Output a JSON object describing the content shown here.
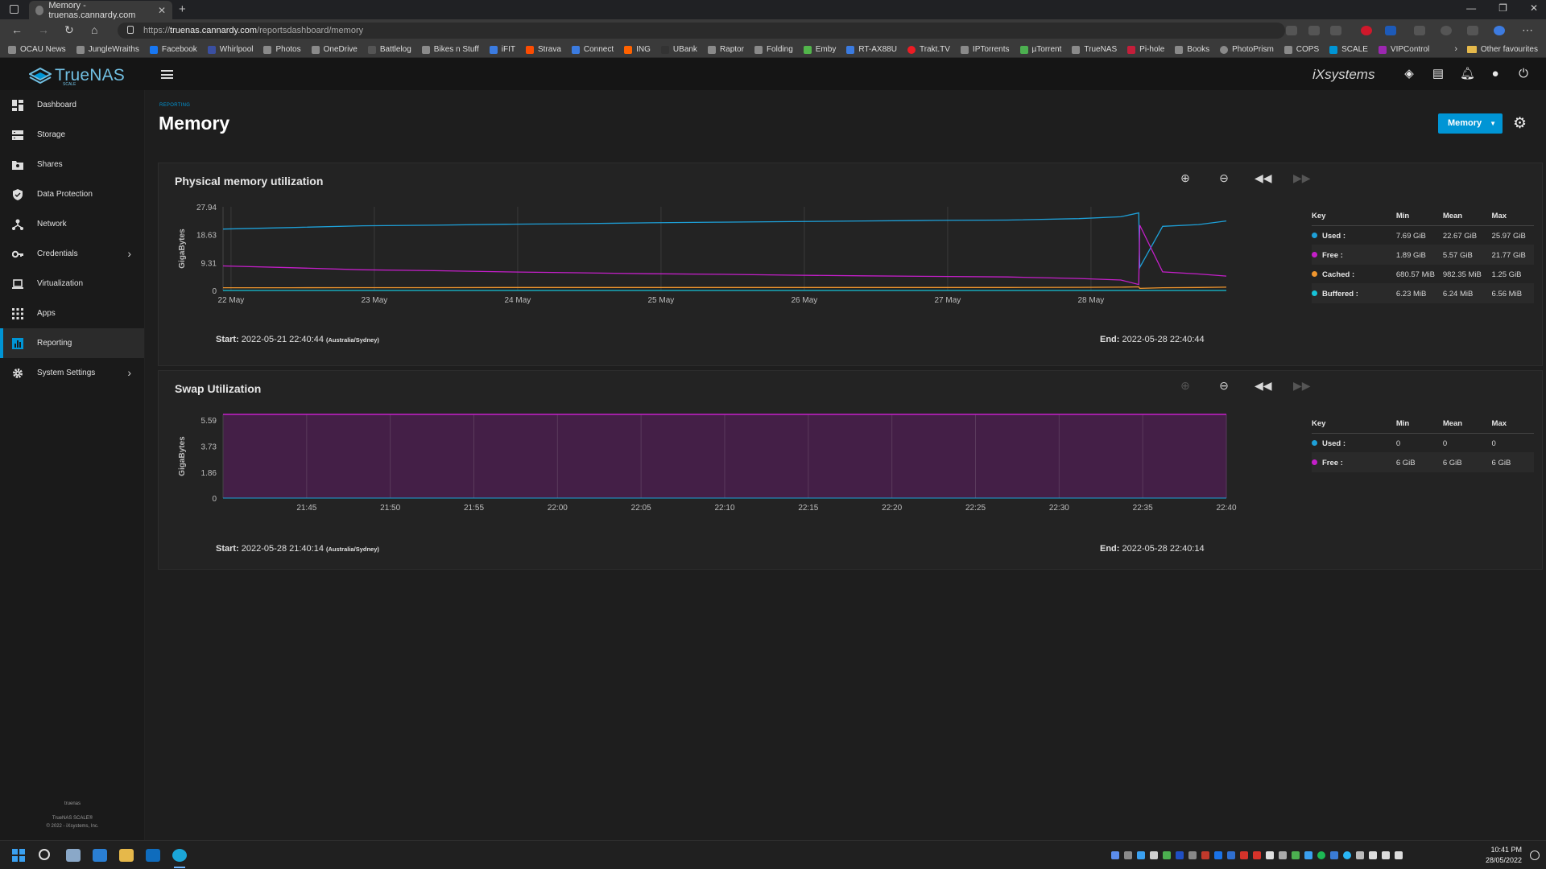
{
  "browser": {
    "tab_title": "Memory - truenas.cannardy.com",
    "url_prefix": "https://",
    "url_host": "truenas.cannardy.com",
    "url_path": "/reportsdashboard/memory",
    "bookmarks": [
      "OCAU News",
      "JungleWraiths",
      "Facebook",
      "Whirlpool",
      "Photos",
      "OneDrive",
      "Battlelog",
      "Bikes n Stuff",
      "iFIT",
      "Strava",
      "Connect",
      "ING",
      "UBank",
      "Raptor",
      "Folding",
      "Emby",
      "RT-AX88U",
      "Trakt.TV",
      "IPTorrents",
      "µTorrent",
      "TrueNAS",
      "Pi-hole",
      "Books",
      "PhotoPrism",
      "COPS",
      "SCALE",
      "VIPControl"
    ],
    "other_favourites": "Other favourites"
  },
  "app": {
    "logo_text": "TrueNAS",
    "logo_sub": "SCALE",
    "vendor": "iXsystems"
  },
  "sidebar": {
    "items": [
      {
        "label": "Dashboard",
        "icon": "dashboard-icon"
      },
      {
        "label": "Storage",
        "icon": "storage-icon"
      },
      {
        "label": "Shares",
        "icon": "shares-icon"
      },
      {
        "label": "Data Protection",
        "icon": "shield-icon"
      },
      {
        "label": "Network",
        "icon": "network-icon"
      },
      {
        "label": "Credentials",
        "icon": "key-icon"
      },
      {
        "label": "Virtualization",
        "icon": "laptop-icon"
      },
      {
        "label": "Apps",
        "icon": "apps-grid-icon"
      },
      {
        "label": "Reporting",
        "icon": "chart-icon"
      },
      {
        "label": "System Settings",
        "icon": "gear-icon"
      }
    ],
    "footer_host": "truenas",
    "footer_product": "TrueNAS SCALE®",
    "footer_copyright": "© 2022 - iXsystems, Inc."
  },
  "page": {
    "breadcrumb": "REPORTING",
    "title": "Memory",
    "selector_label": "Memory"
  },
  "memory_card": {
    "title": "Physical memory utilization",
    "ylabel": "GigaBytes",
    "yticks": [
      "27.94",
      "18.63",
      "9.31",
      "0"
    ],
    "xticks": [
      "22 May",
      "23 May",
      "24 May",
      "25 May",
      "26 May",
      "27 May",
      "28 May"
    ],
    "start_label": "Start:",
    "start_value": "2022-05-21 22:40:44",
    "start_tz": "(Australia/Sydney)",
    "end_label": "End:",
    "end_value": "2022-05-28 22:40:44",
    "legend_headers": [
      "Key",
      "Min",
      "Mean",
      "Max"
    ],
    "legend_rows": [
      {
        "name": "Used :",
        "min": "7.69 GiB",
        "mean": "22.67 GiB",
        "max": "25.97 GiB",
        "color": "#1ea0d8"
      },
      {
        "name": "Free :",
        "min": "1.89 GiB",
        "mean": "5.57 GiB",
        "max": "21.77 GiB",
        "color": "#c41fc9"
      },
      {
        "name": "Cached :",
        "min": "680.57 MiB",
        "mean": "982.35 MiB",
        "max": "1.25 GiB",
        "color": "#f0962e"
      },
      {
        "name": "Buffered :",
        "min": "6.23 MiB",
        "mean": "6.24 MiB",
        "max": "6.56 MiB",
        "color": "#16c3d8"
      }
    ]
  },
  "swap_card": {
    "title": "Swap Utilization",
    "ylabel": "GigaBytes",
    "yticks": [
      "5.59",
      "3.73",
      "1.86",
      "0"
    ],
    "xticks": [
      "21:45",
      "21:50",
      "21:55",
      "22:00",
      "22:05",
      "22:10",
      "22:15",
      "22:20",
      "22:25",
      "22:30",
      "22:35",
      "22:40"
    ],
    "start_label": "Start:",
    "start_value": "2022-05-28 21:40:14",
    "start_tz": "(Australia/Sydney)",
    "end_label": "End:",
    "end_value": "2022-05-28 22:40:14",
    "legend_headers": [
      "Key",
      "Min",
      "Mean",
      "Max"
    ],
    "legend_rows": [
      {
        "name": "Used :",
        "min": "0",
        "mean": "0",
        "max": "0",
        "color": "#1ea0d8"
      },
      {
        "name": "Free :",
        "min": "6 GiB",
        "mean": "6 GiB",
        "max": "6 GiB",
        "color": "#c41fc9"
      }
    ]
  },
  "chart_data": [
    {
      "type": "line",
      "title": "Physical memory utilization",
      "ylabel": "GigaBytes",
      "ylim": [
        0,
        27.94
      ],
      "x": [
        "2022-05-21 22:40",
        "2022-05-22 10:00",
        "2022-05-22 22:00",
        "2022-05-23 10:00",
        "2022-05-23 22:00",
        "2022-05-24 10:00",
        "2022-05-24 22:00",
        "2022-05-25 10:00",
        "2022-05-25 22:00",
        "2022-05-26 10:00",
        "2022-05-26 22:00",
        "2022-05-27 10:00",
        "2022-05-27 22:00",
        "2022-05-28 05:00",
        "2022-05-28 08:00",
        "2022-05-28 08:10",
        "2022-05-28 12:00",
        "2022-05-28 18:00",
        "2022-05-28 22:40"
      ],
      "series": [
        {
          "name": "Used",
          "values": [
            20.5,
            21.0,
            21.6,
            21.8,
            22.1,
            22.3,
            22.6,
            22.8,
            23.0,
            23.2,
            23.4,
            23.5,
            24.0,
            24.6,
            25.9,
            7.7,
            21.4,
            22.0,
            23.2
          ]
        },
        {
          "name": "Free",
          "values": [
            8.2,
            7.6,
            6.9,
            6.6,
            6.2,
            5.9,
            5.6,
            5.4,
            5.1,
            4.9,
            4.7,
            4.5,
            4.0,
            3.5,
            2.0,
            21.8,
            6.2,
            5.5,
            4.8
          ]
        },
        {
          "name": "Cached",
          "values": [
            0.9,
            0.9,
            0.95,
            0.95,
            1.0,
            1.0,
            1.0,
            1.0,
            1.0,
            1.0,
            1.0,
            1.0,
            1.05,
            1.1,
            1.2,
            0.7,
            0.9,
            1.0,
            1.1
          ]
        },
        {
          "name": "Buffered",
          "values": [
            0.006,
            0.006,
            0.006,
            0.006,
            0.006,
            0.006,
            0.006,
            0.006,
            0.006,
            0.006,
            0.006,
            0.006,
            0.006,
            0.006,
            0.006,
            0.006,
            0.006,
            0.006,
            0.006
          ]
        }
      ],
      "grid": true,
      "legend": "right"
    },
    {
      "type": "area",
      "title": "Swap Utilization",
      "ylabel": "GigaBytes",
      "ylim": [
        0,
        6
      ],
      "x": [
        "21:40",
        "21:45",
        "21:50",
        "21:55",
        "22:00",
        "22:05",
        "22:10",
        "22:15",
        "22:20",
        "22:25",
        "22:30",
        "22:35",
        "22:40"
      ],
      "series": [
        {
          "name": "Used",
          "values": [
            0,
            0,
            0,
            0,
            0,
            0,
            0,
            0,
            0,
            0,
            0,
            0,
            0
          ]
        },
        {
          "name": "Free",
          "values": [
            6,
            6,
            6,
            6,
            6,
            6,
            6,
            6,
            6,
            6,
            6,
            6,
            6
          ]
        }
      ],
      "grid": true,
      "legend": "right"
    }
  ],
  "taskbar": {
    "clock_time": "10:41 PM",
    "clock_date": "28/05/2022"
  }
}
